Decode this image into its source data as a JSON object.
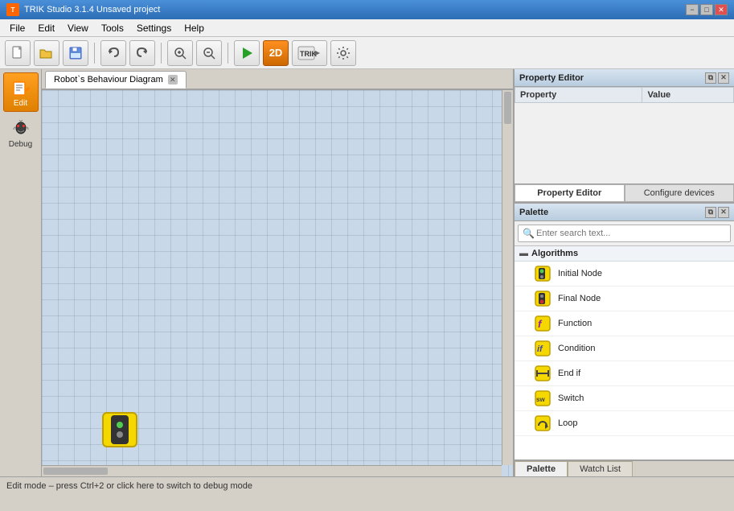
{
  "window": {
    "title": "TRIK Studio 3.1.4 Unsaved project"
  },
  "menu": {
    "items": [
      "File",
      "Edit",
      "View",
      "Tools",
      "Settings",
      "Help"
    ]
  },
  "toolbar": {
    "buttons": [
      {
        "name": "open-folder-button",
        "icon": "📁",
        "title": "Open"
      },
      {
        "name": "save-button",
        "icon": "💾",
        "title": "Save"
      },
      {
        "name": "undo-button",
        "icon": "↩",
        "title": "Undo"
      },
      {
        "name": "redo-button",
        "icon": "↪",
        "title": "Redo"
      },
      {
        "name": "zoom-in-button",
        "icon": "🔍+",
        "title": "Zoom In"
      },
      {
        "name": "zoom-out-button",
        "icon": "🔍−",
        "title": "Zoom Out"
      },
      {
        "name": "run-button",
        "icon": "▶",
        "title": "Run",
        "active": false
      },
      {
        "name": "2d-mode-button",
        "icon": "2D",
        "title": "2D Mode",
        "active": true
      },
      {
        "name": "trik-button",
        "icon": "TRIK",
        "title": "TRIK"
      },
      {
        "name": "settings-button",
        "icon": "⚙",
        "title": "Settings"
      }
    ]
  },
  "left_sidebar": {
    "tools": [
      {
        "name": "edit-tool",
        "label": "Edit",
        "icon": "✏",
        "active": true
      },
      {
        "name": "debug-tool",
        "label": "Debug",
        "icon": "🐛",
        "active": false
      }
    ]
  },
  "tab_bar": {
    "tabs": [
      {
        "name": "robot-behaviour-tab",
        "label": "Robot`s Behaviour Diagram",
        "active": true
      }
    ]
  },
  "property_editor": {
    "title": "Property Editor",
    "columns": [
      "Property",
      "Value"
    ],
    "rows": []
  },
  "prop_bottom_tabs": {
    "tabs": [
      {
        "label": "Property Editor",
        "active": true
      },
      {
        "label": "Configure devices",
        "active": false
      }
    ]
  },
  "palette": {
    "title": "Palette",
    "search_placeholder": "Enter search text...",
    "sections": [
      {
        "name": "algorithms",
        "label": "Algorithms",
        "expanded": true,
        "items": [
          {
            "name": "initial-node-item",
            "label": "Initial Node",
            "icon_type": "initial"
          },
          {
            "name": "final-node-item",
            "label": "Final Node",
            "icon_type": "final"
          },
          {
            "name": "function-item",
            "label": "Function",
            "icon_type": "function"
          },
          {
            "name": "condition-item",
            "label": "Condition",
            "icon_type": "condition"
          },
          {
            "name": "end-if-item",
            "label": "End if",
            "icon_type": "endif"
          },
          {
            "name": "switch-item",
            "label": "Switch",
            "icon_type": "switch"
          },
          {
            "name": "loop-item",
            "label": "Loop",
            "icon_type": "loop"
          }
        ]
      }
    ]
  },
  "palette_bottom_tabs": {
    "tabs": [
      {
        "label": "Palette",
        "active": true
      },
      {
        "label": "Watch List",
        "active": false
      }
    ]
  },
  "status_bar": {
    "text": "Edit mode – press Ctrl+2 or click here to switch to debug mode"
  }
}
